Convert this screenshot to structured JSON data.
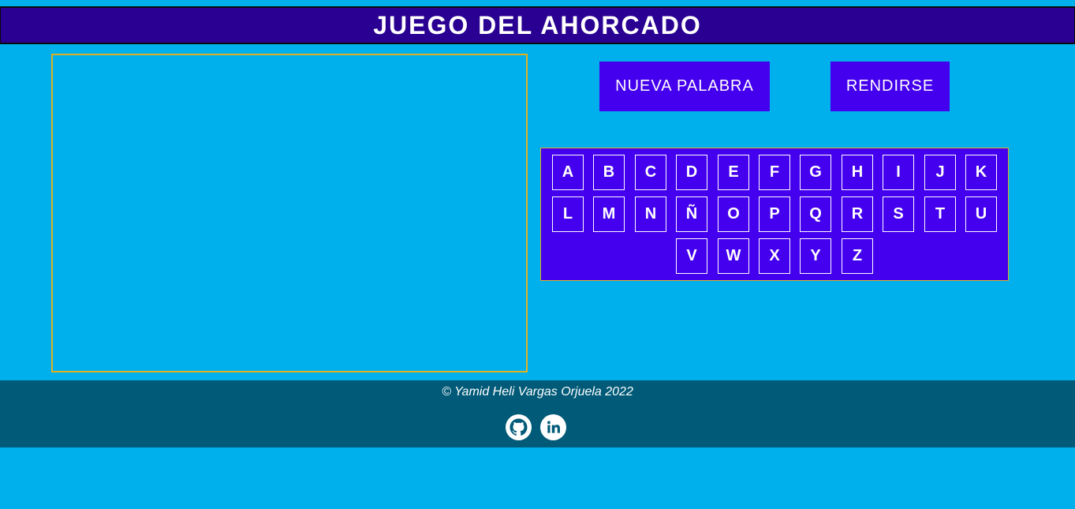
{
  "header": {
    "title": "JUEGO DEL AHORCADO"
  },
  "buttons": {
    "new_word": "NUEVA PALABRA",
    "give_up": "RENDIRSE"
  },
  "keyboard": {
    "rows": [
      [
        "A",
        "B",
        "C",
        "D",
        "E",
        "F",
        "G",
        "H",
        "I",
        "J",
        "K"
      ],
      [
        "L",
        "M",
        "N",
        "Ñ",
        "O",
        "P",
        "Q",
        "R",
        "S",
        "T",
        "U"
      ],
      [
        "V",
        "W",
        "X",
        "Y",
        "Z"
      ]
    ]
  },
  "footer": {
    "copyright": "© Yamid Heli Vargas Orjuela 2022",
    "links": [
      {
        "icon": "github-icon"
      },
      {
        "icon": "linkedin-icon"
      }
    ]
  },
  "colors": {
    "background": "#00b0ec",
    "header": "#290092",
    "button": "#4400ee",
    "canvas_border": "#e0b020",
    "footer": "#005a78"
  }
}
